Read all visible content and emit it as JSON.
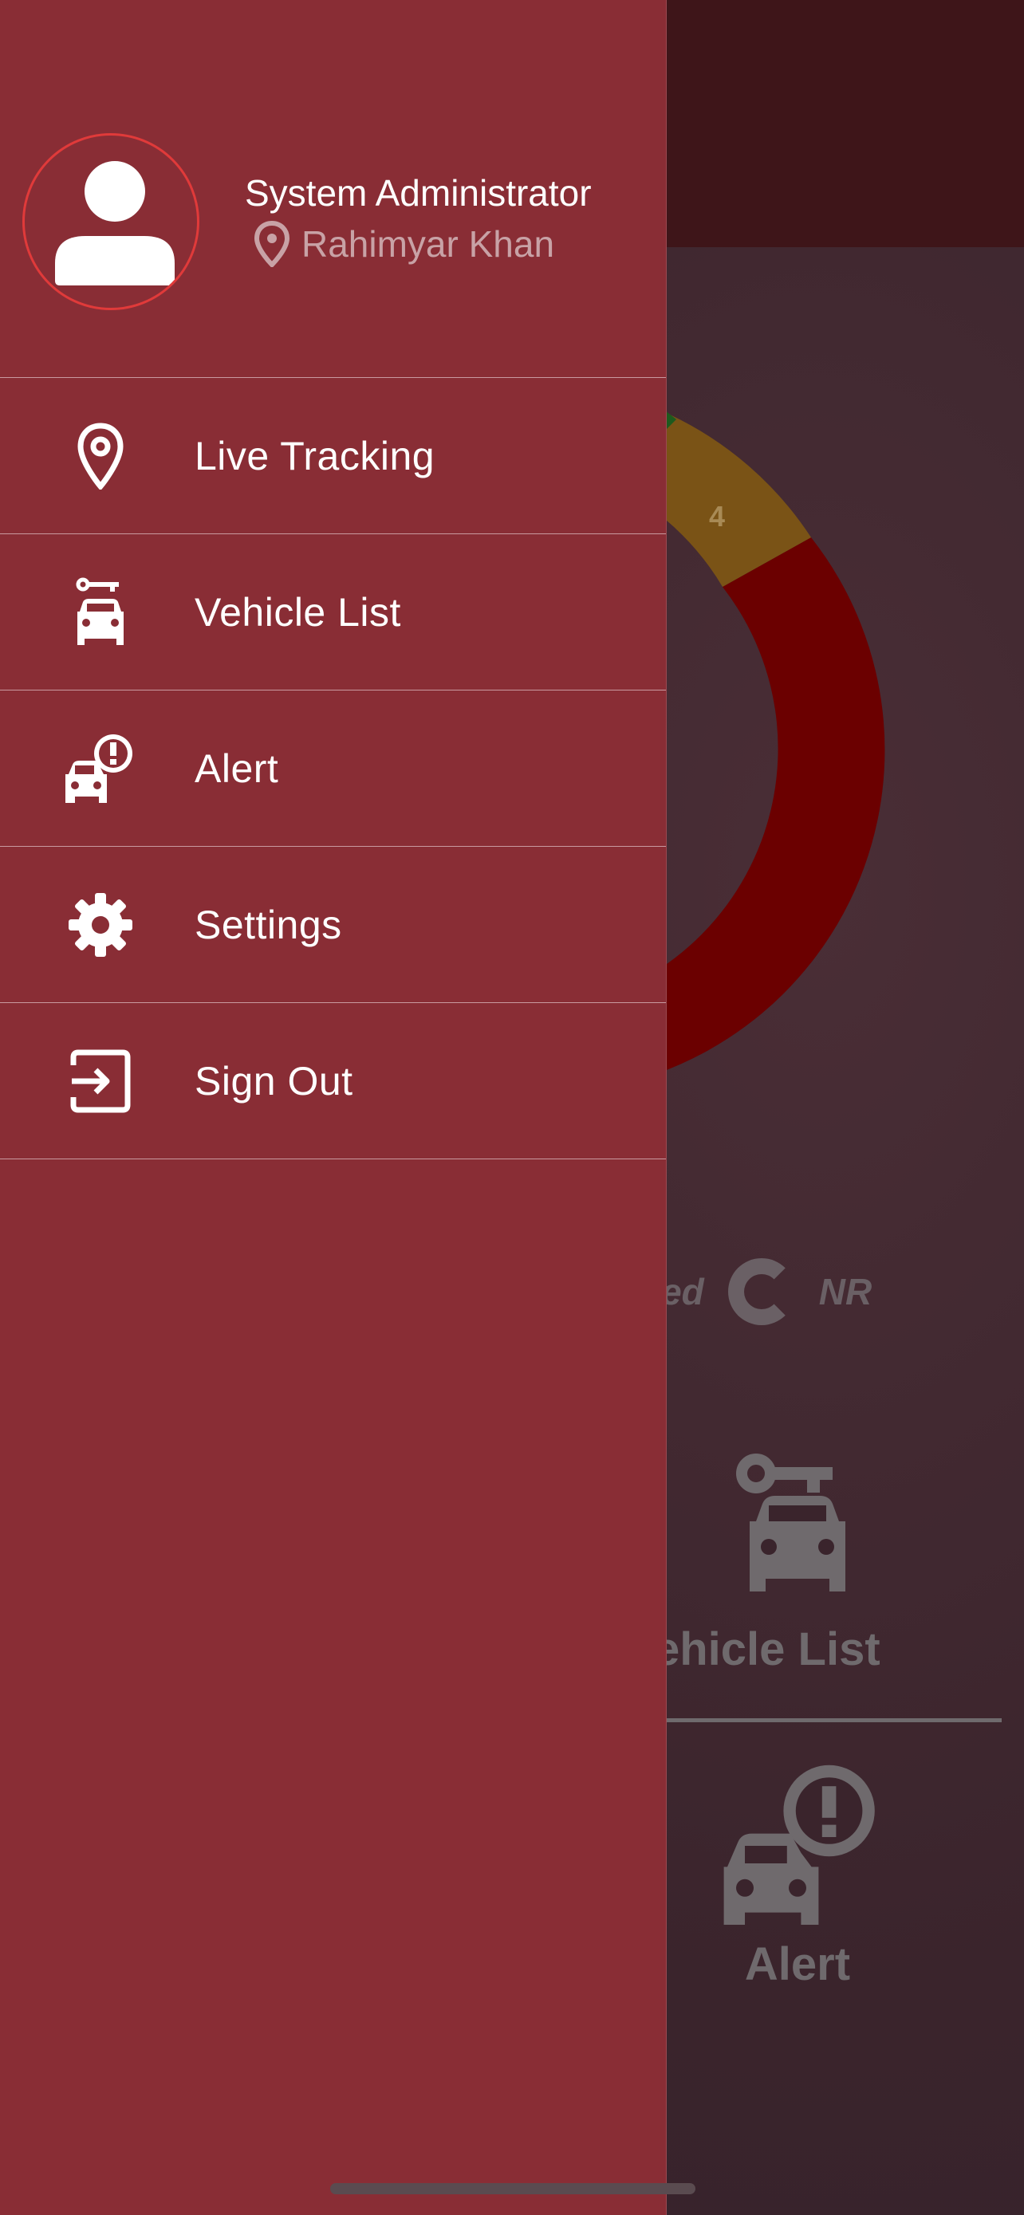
{
  "background": {
    "chart_data": {
      "type": "pie",
      "values": [
        4
      ],
      "labels": [
        "4"
      ]
    },
    "legend": [
      {
        "label": "arked"
      },
      {
        "label": "NR"
      }
    ],
    "tiles": [
      {
        "label": "ehicle List",
        "icon": "car-key-icon"
      },
      {
        "label": "Alert",
        "icon": "car-alert-icon"
      }
    ],
    "colors": {
      "header": "#3e1519",
      "ring_red": "#6b0000",
      "ring_amber": "#7a5316",
      "ring_green": "#1e5a1e"
    }
  },
  "drawer": {
    "user": {
      "name": "System Administrator",
      "location": "Rahimyar Khan"
    },
    "menu": [
      {
        "label": "Live Tracking",
        "icon": "location-pin-icon"
      },
      {
        "label": "Vehicle List",
        "icon": "car-key-icon"
      },
      {
        "label": "Alert",
        "icon": "car-alert-icon"
      },
      {
        "label": "Settings",
        "icon": "gear-icon"
      },
      {
        "label": "Sign Out",
        "icon": "sign-out-icon"
      }
    ],
    "colors": {
      "background": "#892d35",
      "avatar_border": "#e03a3a",
      "text": "#ffffff"
    }
  }
}
